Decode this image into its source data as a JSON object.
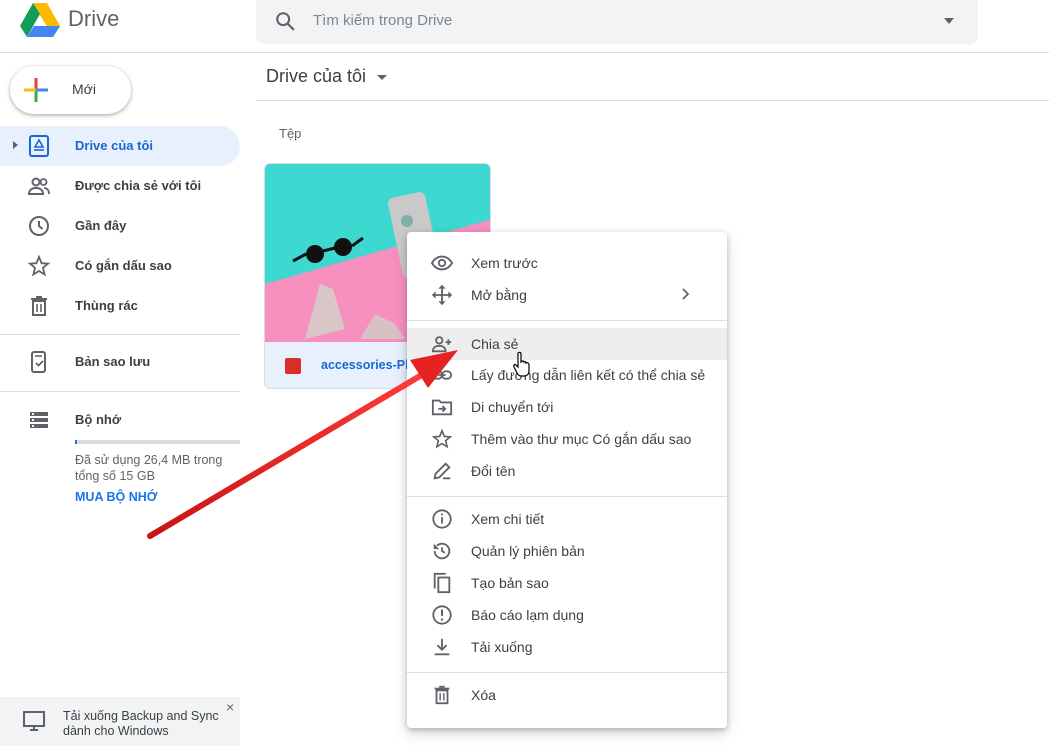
{
  "app": {
    "name": "Drive"
  },
  "search": {
    "placeholder": "Tìm kiếm trong Drive"
  },
  "sidebar": {
    "new_label": "Mới",
    "items": [
      {
        "label": "Drive của tôi",
        "icon": "my-drive-icon",
        "active": true
      },
      {
        "label": "Được chia sẻ với tôi",
        "icon": "shared-people-icon"
      },
      {
        "label": "Gần đây",
        "icon": "clock-icon"
      },
      {
        "label": "Có gắn dấu sao",
        "icon": "star-icon"
      },
      {
        "label": "Thùng rác",
        "icon": "trash-icon"
      }
    ],
    "backups_label": "Bản sao lưu",
    "storage": {
      "label": "Bộ nhớ",
      "usage_text": "Đã sử dụng 26,4 MB trong tổng số 15 GB",
      "used_fraction": 0.002,
      "buy_label": "MUA BỘ NHỚ"
    },
    "backup_sync": {
      "text": "Tải xuống Backup and Sync dành cho Windows",
      "close": "×"
    }
  },
  "main": {
    "breadcrumb": "Drive của tôi",
    "section_label": "Tệp",
    "file": {
      "name": "accessories-Pl",
      "icon": "image-file-icon"
    }
  },
  "context_menu": {
    "groups": [
      [
        {
          "label": "Xem trước",
          "icon": "eye-icon"
        },
        {
          "label": "Mở bằng",
          "icon": "move-arrows-icon",
          "submenu": true
        }
      ],
      [
        {
          "label": "Chia sẻ",
          "icon": "person-add-icon",
          "hover": true
        },
        {
          "label": "Lấy đường dẫn liên kết có thể chia sẻ",
          "icon": "link-icon"
        },
        {
          "label": "Di chuyển tới",
          "icon": "folder-move-icon"
        },
        {
          "label": "Thêm vào thư mục Có gắn dấu sao",
          "icon": "star-icon"
        },
        {
          "label": "Đổi tên",
          "icon": "pencil-icon"
        }
      ],
      [
        {
          "label": "Xem chi tiết",
          "icon": "info-icon"
        },
        {
          "label": "Quản lý phiên bản",
          "icon": "history-icon"
        },
        {
          "label": "Tạo bản sao",
          "icon": "copy-icon"
        },
        {
          "label": "Báo cáo lạm dụng",
          "icon": "report-icon"
        },
        {
          "label": "Tải xuống",
          "icon": "download-icon"
        }
      ],
      [
        {
          "label": "Xóa",
          "icon": "trash-icon"
        }
      ]
    ]
  },
  "colors": {
    "accent": "#1a73e8",
    "active_bg": "#e8f0fe",
    "arrow": "#e02020"
  }
}
